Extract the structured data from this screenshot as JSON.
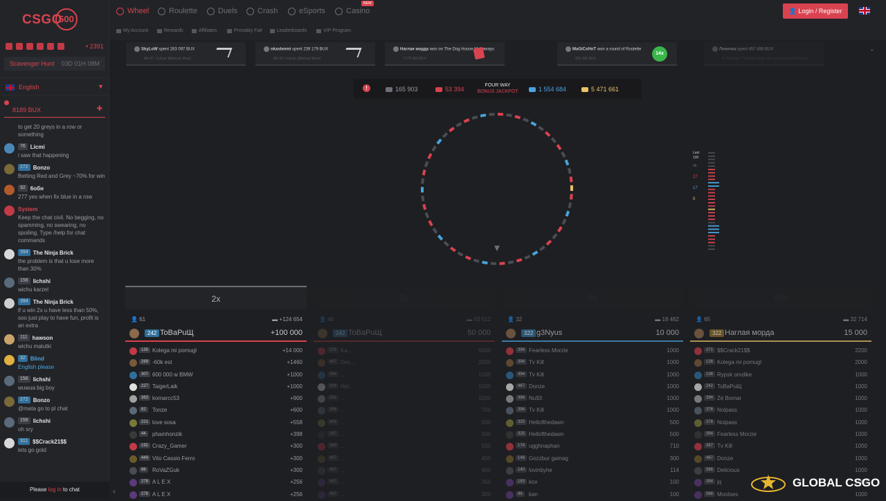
{
  "logo": {
    "text": "CSGO",
    "num": "500"
  },
  "sidebar": {
    "online": "• 2391",
    "hunt_label": "Scavenger Hunt",
    "hunt_time": "03D 01H 08M",
    "language": "English",
    "bux": "8189 BUX",
    "chat_top": "to get 20 greys in a row or something",
    "chat": [
      {
        "lvl": "76",
        "name": "Licmi",
        "text": "i saw that happening",
        "lvl_color": "grey"
      },
      {
        "lvl": "272",
        "name": "Bonzo",
        "text": "Betting Red and Grey ~70% for win",
        "lvl_color": "blue"
      },
      {
        "lvl": "92",
        "name": "6обн",
        "text": "277 yes when fix blue in a row",
        "lvl_color": "grey"
      },
      {
        "lvl": "",
        "name": "System",
        "text": "Keep the chat civil. No begging, no spamming, no swearing, no spoiling. Type /help for chat commands",
        "lvl_color": "none"
      },
      {
        "lvl": "394",
        "name": "The Ninja Brick",
        "text": "the problem is that u lose more than 30%",
        "lvl_color": "blue"
      },
      {
        "lvl": "156",
        "name": "lichshi",
        "text": "wichu karzel",
        "lvl_color": "grey"
      },
      {
        "lvl": "394",
        "name": "The Ninja Brick",
        "text": "if u win 2x u have less than 50%, soo just play to have fun, profit is an extra",
        "lvl_color": "blue"
      },
      {
        "lvl": "111",
        "name": "hawson",
        "text": "wichu malutki",
        "lvl_color": "grey"
      },
      {
        "lvl": "32",
        "name": "Blind",
        "text": "English please",
        "lvl_color": "blue"
      },
      {
        "lvl": "156",
        "name": "lichshi",
        "text": "wuwua big boy",
        "lvl_color": "grey"
      },
      {
        "lvl": "272",
        "name": "Bonzo",
        "text": "@mata go to pl chat",
        "lvl_color": "blue"
      },
      {
        "lvl": "156",
        "name": "lichshi",
        "text": "oh sry",
        "lvl_color": "grey"
      },
      {
        "lvl": "311",
        "name": "$$Crack21$$",
        "text": "lets go gold",
        "lvl_color": "blue"
      }
    ],
    "foot_pre": "Please ",
    "foot_link": "log in",
    "foot_post": " to chat"
  },
  "nav": {
    "items": [
      "Wheel",
      "Roulette",
      "Duels",
      "Crash",
      "eSports",
      "Casino"
    ],
    "new_badge": "NEW",
    "sub": [
      "My Account",
      "Rewards",
      "Affiliates",
      "Provably Fair",
      "Leaderboards",
      "VIP Program"
    ],
    "login": "Login / Register"
  },
  "ticker": [
    {
      "user": "SkyLoW",
      "action": "spent 263 097 BUX",
      "detail": "AK-47 | Vulcan (Minimal Wear)"
    },
    {
      "user": "nkaslenmi",
      "action": "spent 239 179 BUX",
      "detail": "AK-47 | Vulcan (Minimal Wear)"
    },
    {
      "user": "Наглая морда",
      "action": "won on The Dog House Megaways",
      "detail": "2 275 000 BUX"
    },
    {
      "user": "MaGiCsHoT",
      "action": "won a round of Roulette",
      "detail": "429 000 BUX",
      "badge": "14x"
    },
    {
      "user": "Леничка",
      "action": "spent 457 488 BUX",
      "detail": "★ StatTrak™ Butterfly Knife | Boreal Forest (Well-Worn)"
    }
  ],
  "jackpot": {
    "title": "FOUR WAY",
    "subtitle": "BONUS JACKPOT",
    "grey": "165 903",
    "red": "53 394",
    "blue": "1 554 684",
    "gold": "5 471 661"
  },
  "last": {
    "title": "Last",
    "count": "100",
    "vals": [
      "46",
      "27",
      "17",
      "0"
    ]
  },
  "columns": [
    {
      "label": "2x",
      "count": "61",
      "total": "+124 654",
      "lvl": "242",
      "lead": "ToBaPuЩ",
      "lead_amt": "+100 000",
      "rows": [
        [
          "135",
          "Kolega mi pomugl",
          "+14 000"
        ],
        [
          "269",
          "-60k est",
          "+1460"
        ],
        [
          "307",
          "600 000 w BMW",
          "+1000"
        ],
        [
          "227",
          "TaigerLaik",
          "+1000"
        ],
        [
          "363",
          "komarcc53",
          "+900"
        ],
        [
          "82",
          "Tonze",
          "+600"
        ],
        [
          "221",
          "love sosa",
          "+558"
        ],
        [
          "44",
          "phamhonzik",
          "+398"
        ],
        [
          "192",
          "Crazy_Gamer",
          "+300"
        ],
        [
          "449",
          "Vito Cassio Ferro",
          "+300"
        ],
        [
          "86",
          "RoVaZGuk",
          "+300"
        ],
        [
          "278",
          "A L E X",
          "+256"
        ],
        [
          "278",
          "A L E X",
          "+256"
        ]
      ]
    },
    {
      "label": "3x",
      "count": "46",
      "total": "63 512",
      "lvl": "242",
      "lead": "ToBaPuЩ",
      "lead_amt": "50 000",
      "rows": [
        [
          "278",
          "Ka...",
          "5000"
        ],
        [
          "467",
          "Dex...",
          "2000"
        ],
        [
          "286",
          "...",
          "1500"
        ],
        [
          "336",
          "Hel...",
          "1000"
        ],
        [
          "281",
          "...",
          "1000"
        ],
        [
          "396",
          "...",
          "700"
        ],
        [
          "406",
          "...",
          "500"
        ],
        [
          "367",
          "...",
          "500"
        ],
        [
          "260",
          "...",
          "500"
        ],
        [
          "467",
          "...",
          "400"
        ],
        [
          "467",
          "...",
          "400"
        ],
        [
          "467",
          "...",
          "350"
        ],
        [
          "467",
          "...",
          "300"
        ]
      ]
    },
    {
      "label": "5x",
      "count": "32",
      "total": "18 462",
      "lvl": "322",
      "lead": "g3Nyus",
      "lead_amt": "10 000",
      "rows": [
        [
          "394",
          "Fearless Morzie",
          "1000"
        ],
        [
          "394",
          "Tv Kill",
          "1000"
        ],
        [
          "394",
          "Tv Kill",
          "1000"
        ],
        [
          "467",
          "Donze",
          "1000"
        ],
        [
          "394",
          "Nu93",
          "1000"
        ],
        [
          "394",
          "Tv Kill",
          "1000"
        ],
        [
          "325",
          "Hellofthedawn",
          "500"
        ],
        [
          "325",
          "Hellofthedawn",
          "500"
        ],
        [
          "174",
          "ugghnaphan",
          "710"
        ],
        [
          "148",
          "Gozzbur gamag",
          "300"
        ],
        [
          "140",
          "lovinbyhe",
          "114"
        ],
        [
          "183",
          "kox",
          "100"
        ],
        [
          "86",
          "kan",
          "100"
        ]
      ]
    },
    {
      "label": "50x",
      "count": "65",
      "total": "32 714",
      "lvl": "322",
      "lead": "Наглая морда",
      "lead_amt": "15 000",
      "rows": [
        [
          "271",
          "$$Crack21$$",
          "2200"
        ],
        [
          "136",
          "Kolega mi pomugl",
          "2000"
        ],
        [
          "136",
          "Rypsk omdike",
          "1000"
        ],
        [
          "242",
          "ToBaPuЩ",
          "1000"
        ],
        [
          "394",
          "Zé Bomar",
          "1000"
        ],
        [
          "376",
          "Nolpass",
          "1000"
        ],
        [
          "376",
          "Nolpass",
          "1000"
        ],
        [
          "394",
          "Fearless Morzie",
          "1000"
        ],
        [
          "367",
          "Tv Kill",
          "1000"
        ],
        [
          "467",
          "Donze",
          "1000"
        ],
        [
          "386",
          "Delicious",
          "1000"
        ],
        [
          "394",
          "jq",
          "1000"
        ],
        [
          "386",
          "Mootses",
          "1000"
        ]
      ]
    }
  ],
  "watermark": "GLOBAL CSGO"
}
